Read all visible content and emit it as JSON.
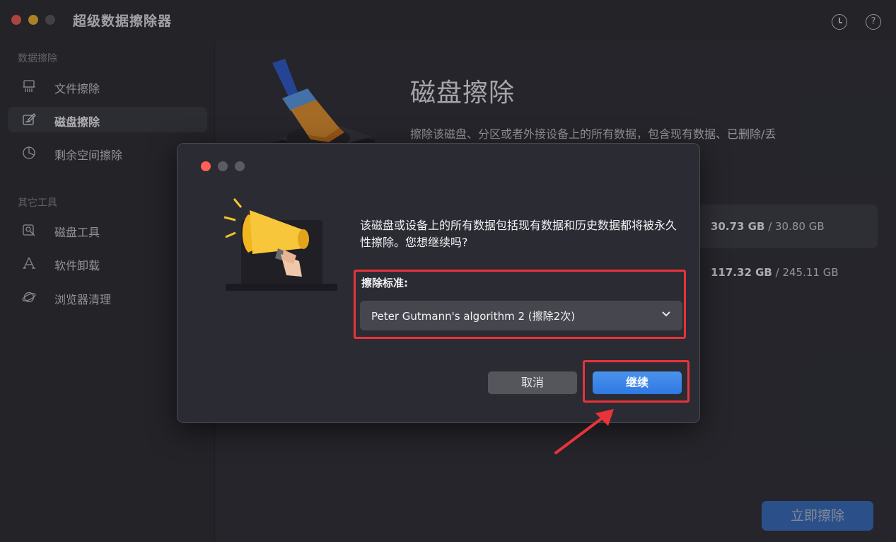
{
  "app": {
    "title": "超级数据擦除器",
    "help_icon_glyph": "?"
  },
  "sidebar": {
    "section1_title": "数据擦除",
    "section2_title": "其它工具",
    "items": [
      {
        "label": "文件擦除",
        "icon": "shredder-icon"
      },
      {
        "label": "磁盘擦除",
        "icon": "disk-edit-icon",
        "active": true
      },
      {
        "label": "剩余空间擦除",
        "icon": "pie-chart-icon"
      },
      {
        "label": "磁盘工具",
        "icon": "disk-tool-icon"
      },
      {
        "label": "软件卸载",
        "icon": "uninstall-icon"
      },
      {
        "label": "浏览器清理",
        "icon": "browser-icon"
      }
    ]
  },
  "main": {
    "title": "磁盘擦除",
    "description": "擦除该磁盘、分区或者外接设备上的所有数据，包含现有数据、已删除/丢",
    "disks": [
      {
        "used": "30.73 GB",
        "total": " / 30.80 GB"
      },
      {
        "used": "117.32 GB",
        "total": " / 245.11 GB"
      }
    ],
    "erase_button": "立即擦除"
  },
  "dialog": {
    "message": "该磁盘或设备上的所有数据包括现有数据和历史数据都将被永久性擦除。您想继续吗?",
    "standard_label": "擦除标准:",
    "standard_value": "Peter Gutmann's algorithm 2 (擦除2次)",
    "cancel_label": "取消",
    "continue_label": "继续"
  },
  "colors": {
    "accent": "#3a7be0",
    "annotation_red": "#e8333a"
  }
}
